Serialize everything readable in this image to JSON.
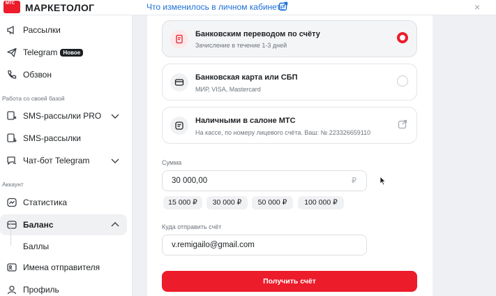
{
  "brand": {
    "logo_mark": "МТС",
    "name": "МАРКЕТОЛОГ",
    "accent": "#ec1c2b"
  },
  "header": {
    "changes_link": "Что изменилось в личном кабинете",
    "close_glyph": "×"
  },
  "sidebar": {
    "top_items": [
      {
        "label": "Рассылки",
        "icon": "megaphone-icon"
      },
      {
        "label": "Telegram",
        "icon": "paper-plane-icon",
        "badge": "Новое"
      },
      {
        "label": "Обзвон",
        "icon": "phone-icon"
      }
    ],
    "section_own_base": "Работа со своей базой",
    "base_items": [
      {
        "label": "SMS-рассылки PRO",
        "icon": "sms-pro-icon"
      },
      {
        "label": "SMS-рассылки",
        "icon": "sms-icon"
      },
      {
        "label": "Чат-бот Telegram",
        "icon": "chat-bot-icon"
      }
    ],
    "section_account": "Аккаунт",
    "account_items": [
      {
        "label": "Статистика",
        "icon": "chart-icon"
      },
      {
        "label": "Баланс",
        "icon": "wallet-icon"
      },
      {
        "label": "Баллы"
      },
      {
        "label": "Имена отправителя",
        "icon": "id-card-icon"
      },
      {
        "label": "Профиль",
        "icon": "user-icon"
      }
    ]
  },
  "payment": {
    "options": [
      {
        "title": "Банковским переводом по счёту",
        "subtitle": "Зачисление в течение 1-3 дней",
        "selected": true
      },
      {
        "title": "Банковская карта или СБП",
        "subtitle": "МИР, VISA, Mastercard",
        "selected": false
      },
      {
        "title": "Наличными в салоне МТС",
        "subtitle": "На кассе, по номеру лицевого счёта. Ваш: № 223326659110",
        "selected": false
      }
    ],
    "amount_label": "Сумма",
    "amount_value": "30 000,00",
    "currency": "₽",
    "presets": [
      "15 000 ₽",
      "30 000 ₽",
      "50 000 ₽",
      "100 000 ₽"
    ],
    "email_label": "Куда отправить счёт",
    "email_value": "v.remigailo@gmail.com",
    "submit_label": "Получить счёт"
  }
}
